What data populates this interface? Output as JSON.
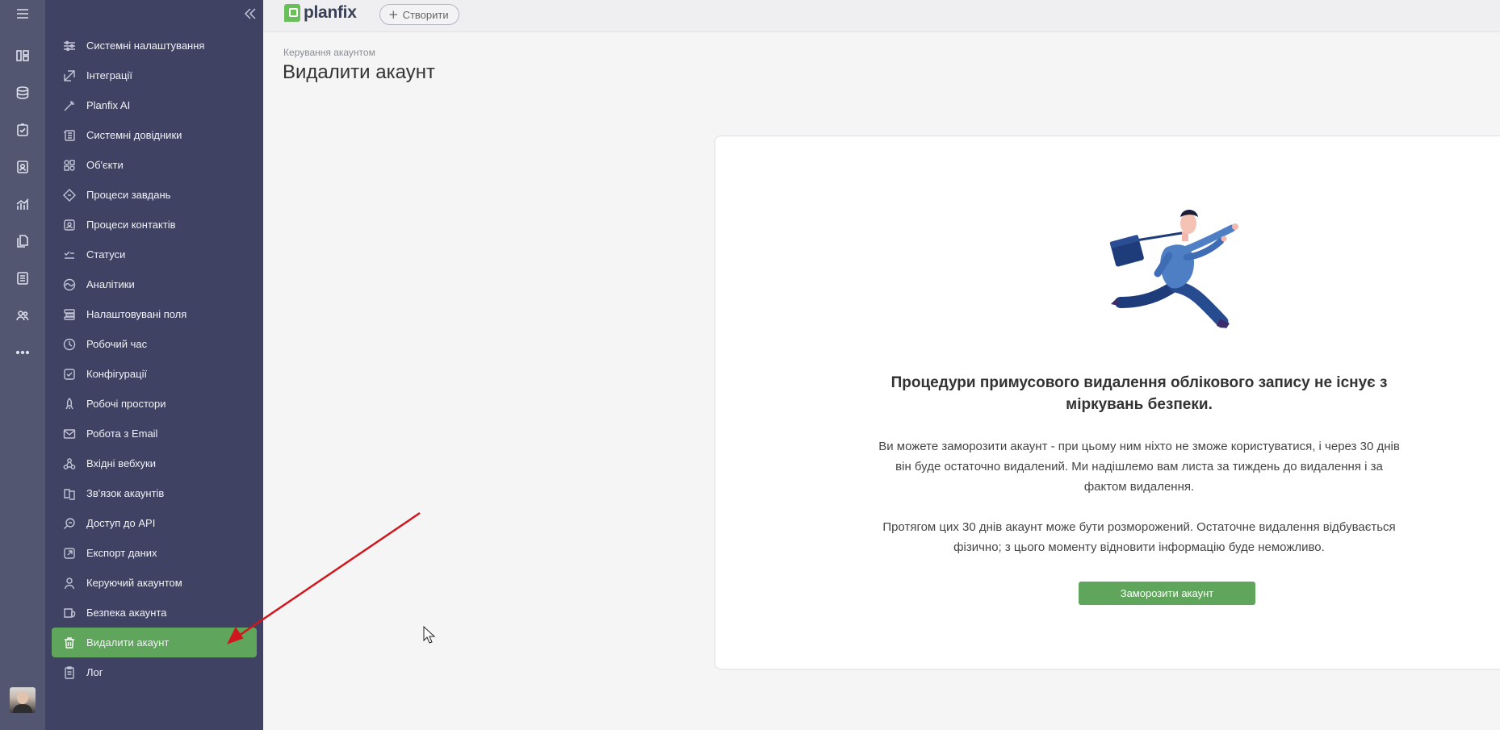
{
  "app": {
    "logo_text": "planfix",
    "create_label": "Створити",
    "create_plus": "+"
  },
  "rail": {
    "icons": [
      "menu-icon",
      "board-icon",
      "database-icon",
      "tasks-icon",
      "contacts-icon",
      "analytics-icon",
      "documents-icon",
      "list-icon",
      "users-icon",
      "more-icon"
    ]
  },
  "sidebar": {
    "items": [
      {
        "label": "Системні налаштування",
        "icon": "sliders-icon"
      },
      {
        "label": "Інтеграції",
        "icon": "integrations-icon"
      },
      {
        "label": "Planfix AI",
        "icon": "magic-wand-icon"
      },
      {
        "label": "Системні довідники",
        "icon": "directories-icon"
      },
      {
        "label": "Об'єкти",
        "icon": "objects-icon"
      },
      {
        "label": "Процеси завдань",
        "icon": "task-process-icon"
      },
      {
        "label": "Процеси контактів",
        "icon": "contact-process-icon"
      },
      {
        "label": "Статуси",
        "icon": "statuses-icon"
      },
      {
        "label": "Аналітики",
        "icon": "analytics-icon"
      },
      {
        "label": "Налаштовувані поля",
        "icon": "custom-fields-icon"
      },
      {
        "label": "Робочий час",
        "icon": "clock-icon"
      },
      {
        "label": "Конфігурації",
        "icon": "configurations-icon"
      },
      {
        "label": "Робочі простори",
        "icon": "workspaces-icon"
      },
      {
        "label": "Робота з Email",
        "icon": "email-icon"
      },
      {
        "label": "Вхідні вебхуки",
        "icon": "webhooks-icon"
      },
      {
        "label": "Зв'язок акаунтів",
        "icon": "account-link-icon"
      },
      {
        "label": "Доступ до API",
        "icon": "api-icon"
      },
      {
        "label": "Експорт даних",
        "icon": "export-icon"
      },
      {
        "label": "Керуючий акаунтом",
        "icon": "account-manager-icon"
      },
      {
        "label": "Безпека акаунта",
        "icon": "security-icon"
      },
      {
        "label": "Видалити акаунт",
        "icon": "trash-icon",
        "active": true
      },
      {
        "label": "Лог",
        "icon": "log-icon"
      }
    ]
  },
  "header": {
    "breadcrumb": "Керування акаунтом",
    "title": "Видалити акаунт"
  },
  "card": {
    "headline": "Процедури примусового видалення облікового запису не існує з міркувань безпеки.",
    "paragraph1": "Ви можете заморозити акаунт - при цьому ним ніхто не зможе користуватися, і через 30 днів він буде остаточно видалений. Ми надішлемо вам листа за тиждень до видалення і за фактом видалення.",
    "paragraph2": "Протягом цих 30 днів акаунт може бути розморожений. Остаточне видалення відбувається фізично; з цього моменту відновити інформацію буде неможливо.",
    "button_label": "Заморозити акаунт"
  },
  "colors": {
    "rail_bg": "#525671",
    "sidebar_bg": "#3f4262",
    "accent_green": "#5fa65c",
    "annotation_arrow": "#d0171d"
  }
}
